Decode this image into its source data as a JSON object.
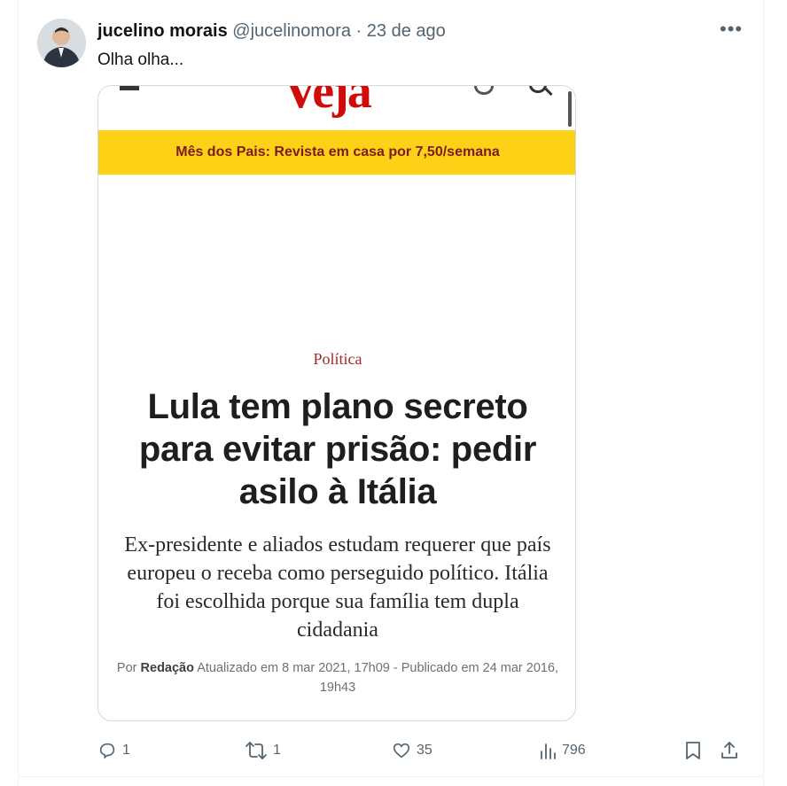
{
  "tweet": {
    "display_name": "jucelino morais",
    "handle": "@jucelinomora",
    "separator": "·",
    "timestamp": "23 de ago",
    "more_label": "•••",
    "text": "Olha olha..."
  },
  "media": {
    "site_logo": "Veja",
    "promo_banner": "Mês dos Pais: Revista em casa por 7,50/semana",
    "section": "Política",
    "headline": "Lula tem plano secreto para evitar prisão: pedir asilo à Itália",
    "subheadline": "Ex-presidente e aliados estudam requerer que país europeu o receba como perseguido político. Itália foi escolhida porque sua família tem dupla cidadania",
    "byline_prefix": "Por",
    "byline_author": "Redação",
    "byline_dates": "Atualizado em 8 mar 2021, 17h09 - Publicado em 24 mar 2016, 19h43"
  },
  "actions": {
    "replies": "1",
    "reposts": "1",
    "likes": "35",
    "views": "796"
  },
  "colors": {
    "brand_red": "#d10a0a",
    "banner_yellow": "#fcd116",
    "icon_gray": "#536471"
  }
}
